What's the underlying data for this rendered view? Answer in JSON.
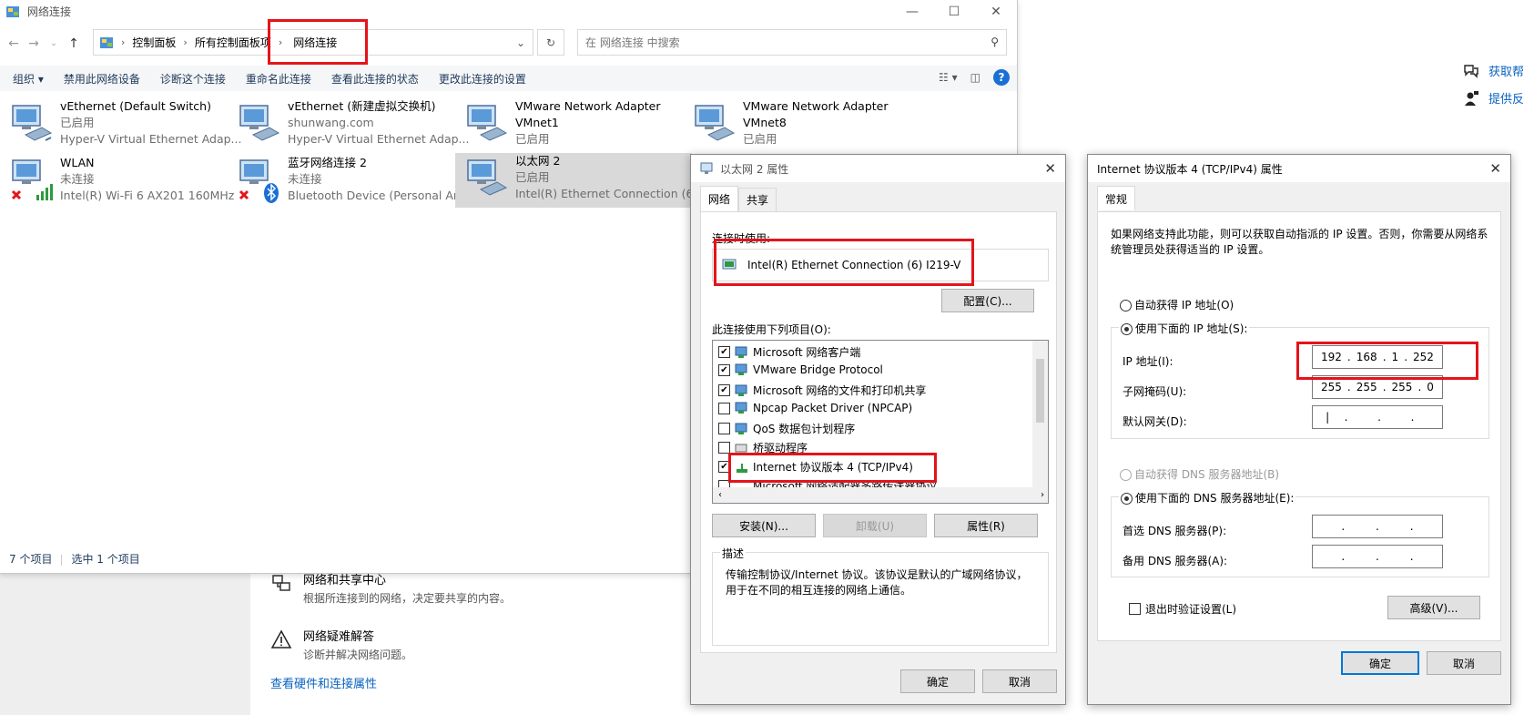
{
  "explorer": {
    "title": "网络连接",
    "breadcrumb": [
      "控制面板",
      "所有控制面板项",
      "网络连接"
    ],
    "search_placeholder": "在 网络连接 中搜索",
    "commands": [
      "组织",
      "禁用此网络设备",
      "诊断这个连接",
      "重命名此连接",
      "查看此连接的状态",
      "更改此连接的设置"
    ],
    "items": [
      {
        "name": "vEthernet (Default Switch)",
        "status": "已启用",
        "device": "Hyper-V Virtual Ethernet Adap..."
      },
      {
        "name": "vEthernet (新建虚拟交换机)",
        "status": "shunwang.com",
        "device": "Hyper-V Virtual Ethernet Adap..."
      },
      {
        "name": "VMware Network Adapter",
        "status": "VMnet1",
        "device": "已启用"
      },
      {
        "name": "VMware Network Adapter",
        "status": "VMnet8",
        "device": "已启用"
      },
      {
        "name": "WLAN",
        "status": "未连接",
        "device": "Intel(R) Wi-Fi 6 AX201 160MHz"
      },
      {
        "name": "蓝牙网络连接 2",
        "status": "未连接",
        "device": "Bluetooth Device (Personal Ar..."
      },
      {
        "name": "以太网 2",
        "status": "已启用",
        "device": "Intel(R) Ethernet Connection (6..."
      }
    ],
    "status_count": "7 个项目",
    "status_selected": "选中 1 个项目"
  },
  "settings": {
    "sharing_title": "网络和共享中心",
    "sharing_desc": "根据所连接到的网络，决定要共享的内容。",
    "troubleshoot_title": "网络疑难解答",
    "troubleshoot_desc": "诊断并解决网络问题。",
    "hardware_link": "查看硬件和连接属性",
    "help_1": "获取帮",
    "help_2": "提供反"
  },
  "eth_dialog": {
    "title": "以太网 2 属性",
    "tabs": [
      "网络",
      "共享"
    ],
    "connect_using_label": "连接时使用:",
    "adapter": "Intel(R) Ethernet Connection (6) I219-V",
    "configure_btn": "配置(C)...",
    "items_label": "此连接使用下列项目(O):",
    "list": [
      {
        "label": "Microsoft 网络客户端",
        "checked": "✔"
      },
      {
        "label": "VMware Bridge Protocol",
        "checked": "✔"
      },
      {
        "label": "Microsoft 网络的文件和打印机共享",
        "checked": "✔"
      },
      {
        "label": "Npcap Packet Driver (NPCAP)",
        "checked": ""
      },
      {
        "label": "QoS 数据包计划程序",
        "checked": ""
      },
      {
        "label": "桥驱动程序",
        "checked": ""
      },
      {
        "label": "Internet 协议版本 4 (TCP/IPv4)",
        "checked": "✔"
      },
      {
        "label": "Microsoft 网络适配器多路传送器协议",
        "checked": ""
      }
    ],
    "install_btn": "安装(N)...",
    "uninstall_btn": "卸载(U)",
    "properties_btn": "属性(R)",
    "description_label": "描述",
    "description": "传输控制协议/Internet 协议。该协议是默认的广域网络协议，用于在不同的相互连接的网络上通信。",
    "ok_btn": "确定",
    "cancel_btn": "取消"
  },
  "ipv4_dialog": {
    "title": "Internet 协议版本 4 (TCP/IPv4) 属性",
    "tab": "常规",
    "info": "如果网络支持此功能，则可以获取自动指派的 IP 设置。否则，你需要从网络系统管理员处获得适当的 IP 设置。",
    "auto_ip": "自动获得 IP 地址(O)",
    "manual_ip": "使用下面的 IP 地址(S):",
    "ip_label": "IP 地址(I):",
    "ip_value": [
      "192",
      "168",
      "1",
      "252"
    ],
    "mask_label": "子网掩码(U):",
    "mask_value": [
      "255",
      "255",
      "255",
      "0"
    ],
    "gateway_label": "默认网关(D):",
    "auto_dns": "自动获得 DNS 服务器地址(B)",
    "manual_dns": "使用下面的 DNS 服务器地址(E):",
    "dns1_label": "首选 DNS 服务器(P):",
    "dns2_label": "备用 DNS 服务器(A):",
    "validate": "退出时验证设置(L)",
    "advanced_btn": "高级(V)...",
    "ok_btn": "确定",
    "cancel_btn": "取消"
  },
  "colors": {
    "highlight_red": "#e3141b",
    "link_blue": "#0b63c1",
    "dialog_bg": "#f0f0f0"
  }
}
